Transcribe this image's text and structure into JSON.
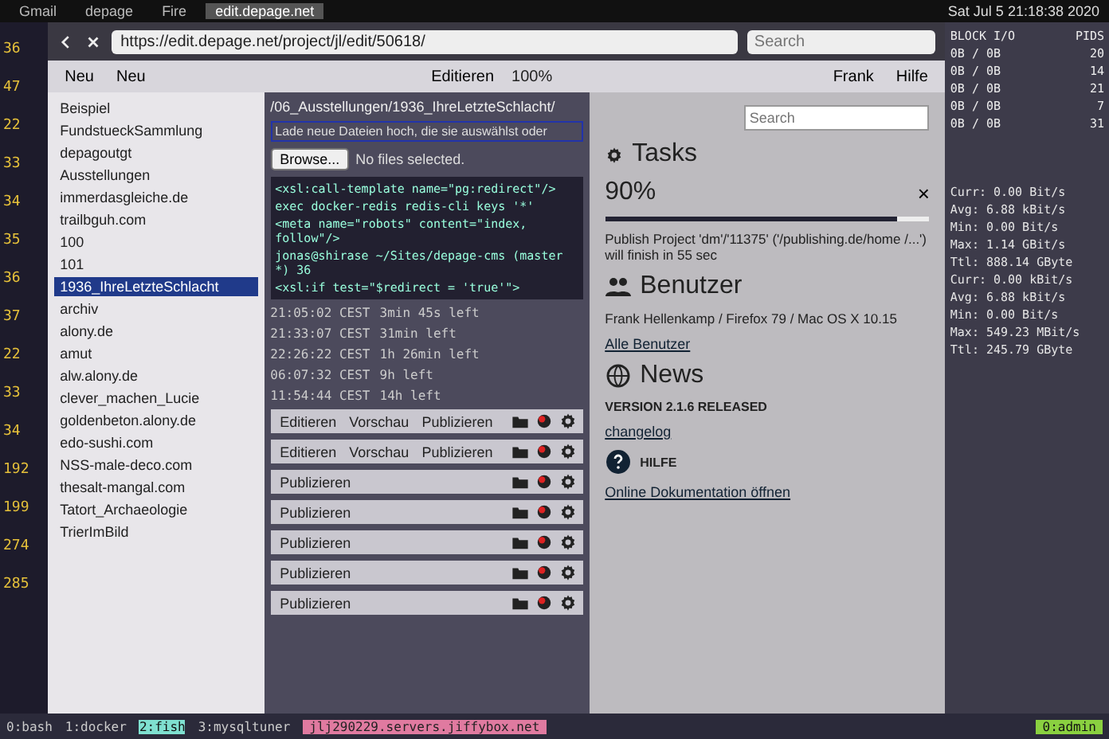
{
  "menubar": {
    "tabs": [
      {
        "label": "Gmail",
        "selected": false
      },
      {
        "label": "depage",
        "selected": false
      },
      {
        "label": "Fire",
        "selected": false
      },
      {
        "label": "edit.depage.net",
        "selected": true
      }
    ],
    "clock": "Sat Jul  5 21:18:38 2020"
  },
  "gutter": {
    "line_numbers": [
      "36",
      "47",
      "22",
      "33",
      "34",
      "35",
      "36",
      "37",
      "22",
      "33",
      "34",
      "192",
      "199",
      "274",
      "285"
    ]
  },
  "browser": {
    "url": "https://edit.depage.net/project/jl/edit/50618/",
    "search_placeholder": "Search",
    "toolbar": [
      "Neu",
      "Neu"
    ],
    "edit_label": "Editieren",
    "zoom": "100%",
    "user": "Frank",
    "help": "Hilfe"
  },
  "tree": {
    "items": [
      {
        "label": "Beispiel",
        "selected": false
      },
      {
        "label": "FundstueckSammlung",
        "selected": false
      },
      {
        "label": "depagoutgt",
        "selected": false
      },
      {
        "label": "Ausstellungen",
        "selected": false
      },
      {
        "label": "immerdasgleiche.de",
        "selected": false
      },
      {
        "label": "trailbguh.com",
        "selected": false
      },
      {
        "label": "100",
        "selected": false
      },
      {
        "label": "101",
        "selected": false
      },
      {
        "label": "1936_IhreLetzteSchlacht",
        "selected": true
      },
      {
        "label": "archiv",
        "selected": false
      },
      {
        "label": "alony.de",
        "selected": false
      },
      {
        "label": "amut",
        "selected": false
      },
      {
        "label": "alw.alony.de",
        "selected": false
      },
      {
        "label": "clever_machen_Lucie",
        "selected": false
      },
      {
        "label": "goldenbeton.alony.de",
        "selected": false
      },
      {
        "label": "edo-sushi.com",
        "selected": false
      },
      {
        "label": "NSS-male-deco.com",
        "selected": false
      },
      {
        "label": "thesalt-mangal.com",
        "selected": false
      },
      {
        "label": "Tatort_Archaeologie",
        "selected": false
      },
      {
        "label": "TrierImBild",
        "selected": false
      }
    ]
  },
  "documents": {
    "path": "/06_Ausstellungen/1936_IhreLetzteSchlacht/",
    "notice": "Lade neue Dateien hoch, die sie auswählst oder",
    "browse_button": "Browse...",
    "file_status": "No files selected.",
    "code": [
      "<xsl:call-template name=\"pg:redirect\"/>",
      "exec docker-redis redis-cli keys '*'",
      "<meta name=\"robots\" content=\"index, follow\"/>",
      "jonas@shirase ~/Sites/depage-cms (master *) 36",
      "<xsl:if test=\"$redirect = 'true'\">"
    ],
    "timers": [
      {
        "next": "21:05:02 CEST",
        "left": "3min 45s left"
      },
      {
        "next": "21:33:07 CEST",
        "left": "31min left"
      },
      {
        "next": "22:26:22 CEST",
        "left": "1h 26min left"
      },
      {
        "next": "06:07:32 CEST",
        "left": "9h left"
      },
      {
        "next": "11:54:44 CEST",
        "left": "14h left"
      }
    ],
    "rows": [
      {
        "actions": [
          "Editieren",
          "Vorschau",
          "Publizieren"
        ]
      },
      {
        "actions": [
          "Editieren",
          "Vorschau",
          "Publizieren"
        ]
      },
      {
        "actions": [
          "Publizieren"
        ]
      },
      {
        "actions": [
          "Publizieren"
        ]
      },
      {
        "actions": [
          "Publizieren"
        ]
      },
      {
        "actions": [
          "Publizieren"
        ]
      },
      {
        "actions": [
          "Publizieren"
        ]
      }
    ]
  },
  "dashboard": {
    "search_placeholder": "Search",
    "tasks": {
      "title": "Tasks",
      "reading": "90%",
      "close": "×",
      "level": 0.9,
      "message": "Publish Project 'dm'/'11375' ('/publishing.de/home /...') will finish in 55 sec"
    },
    "users": {
      "title": "Benutzer",
      "entries": [
        "Frank Hellenkamp / Firefox 79 / Mac OS X 10.15"
      ],
      "link": "Alle Benutzer"
    },
    "news": {
      "title": "News",
      "headline": "VERSION 2.1.6 RELEASED",
      "link": "changelog"
    },
    "help": {
      "title": "HILFE",
      "link": "Online Dokumentation öffnen"
    }
  },
  "stats": {
    "columns": [
      "BLOCK I/O",
      "PIDS"
    ],
    "rows": [
      [
        "0B / 0B",
        "20"
      ],
      [
        "0B / 0B",
        "14"
      ],
      [
        "0B / 0B",
        "21"
      ],
      [
        "0B / 0B",
        "7"
      ],
      [
        "0B / 0B",
        "31"
      ]
    ],
    "net": [
      "Curr: 0.00 Bit/s",
      "Avg: 6.88 kBit/s",
      "Min: 0.00 Bit/s",
      "Max: 1.14 GBit/s",
      "Ttl: 888.14 GByte",
      "Curr: 0.00 kBit/s",
      "Avg: 6.88 kBit/s",
      "Min: 0.00 Bit/s",
      "Max: 549.23 MBit/s",
      "Ttl: 245.79 GByte"
    ]
  },
  "status_bar": {
    "windows": [
      {
        "label": "0:bash",
        "selected": false
      },
      {
        "label": "1:docker",
        "selected": false
      },
      {
        "label": "2:fish",
        "selected": true
      },
      {
        "label": "3:mysqltuner",
        "selected": false
      }
    ],
    "host": "jlj290229.servers.jiffybox.net",
    "session": "0:admin"
  }
}
